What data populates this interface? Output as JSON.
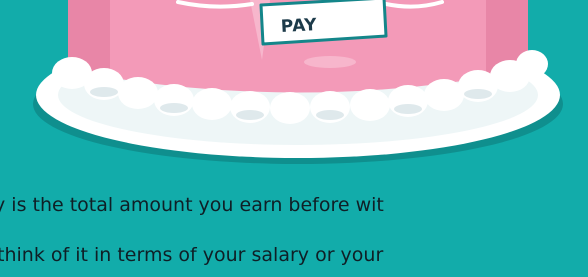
{
  "sign": {
    "label": "PAY"
  },
  "body": {
    "line1": "y is the total amount you earn before wit",
    "line2": "think of it in terms of your salary or your"
  },
  "colors": {
    "background": "#12acaa",
    "cake_pink": "#f39ab8",
    "plate": "#ffffff",
    "frosting": "#ffffff",
    "sign_border": "#14868a",
    "text": "#0f1f26"
  }
}
